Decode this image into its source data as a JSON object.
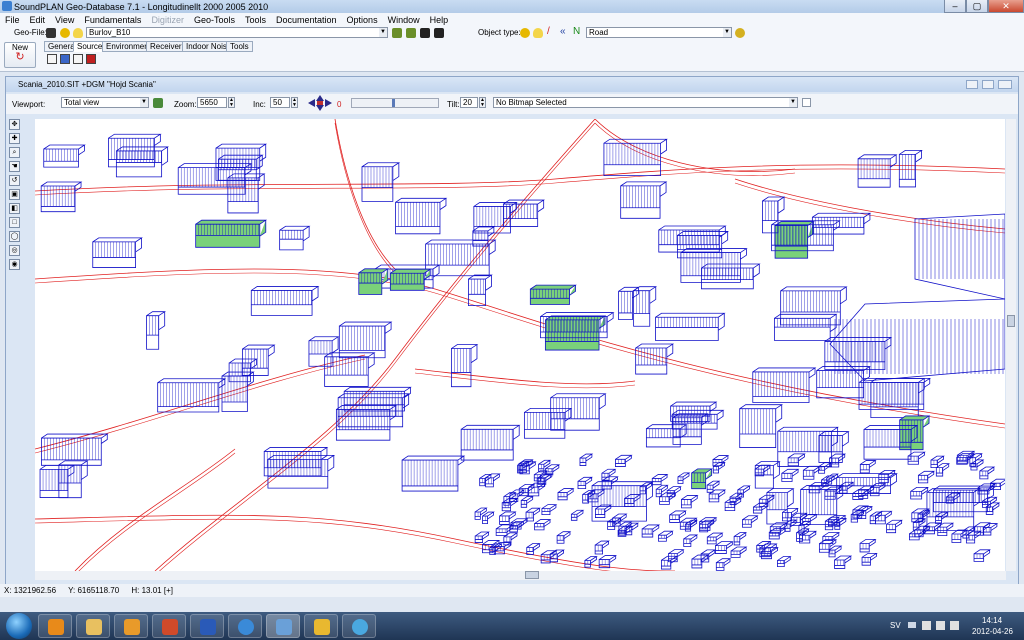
{
  "window": {
    "title": "SoundPLAN Geo-Database 7.1 - Longitudinellt 2000 2005 2010",
    "min_label": "‒",
    "max_label": "▢",
    "close_label": "✕"
  },
  "menu": {
    "items": [
      "File",
      "Edit",
      "View",
      "Fundamentals",
      "Digitizer",
      "Geo-Tools",
      "Tools",
      "Documentation",
      "Options",
      "Window",
      "Help"
    ],
    "disabled": [
      "Digitizer"
    ]
  },
  "geobar": {
    "geofile_label": "Geo-File:",
    "geofile_value": "Burlov_B10",
    "objecttype_label": "Object type:",
    "objecttype_value": "Road"
  },
  "tabs": {
    "new_label": "New",
    "items": [
      "General",
      "Source",
      "Environment",
      "Receivers",
      "Indoor Noise",
      "Tools"
    ],
    "active": "Source"
  },
  "document": {
    "title": "Scania_2010.SIT +DGM \"Hojd Scania\"",
    "viewport_label": "Viewport:",
    "viewport_value": "Total view",
    "zoom_label": "Zoom:",
    "zoom_value": "5650",
    "inc_label": "Inc:",
    "inc_value": "50",
    "angle_value": "0",
    "tilt_label": "Tilt:",
    "tilt_value": "20",
    "bitmap_value": "No Bitmap Selected"
  },
  "status": {
    "x": "X: 1321962.56",
    "y": "Y: 6165118.70",
    "h": "H: 13.01 [+]"
  },
  "tray": {
    "lang": "SV",
    "time": "14:14",
    "date": "2012-04-26"
  },
  "colors": {
    "building": "#1010c8",
    "road": "#e02020",
    "green": "#7ad17a"
  }
}
